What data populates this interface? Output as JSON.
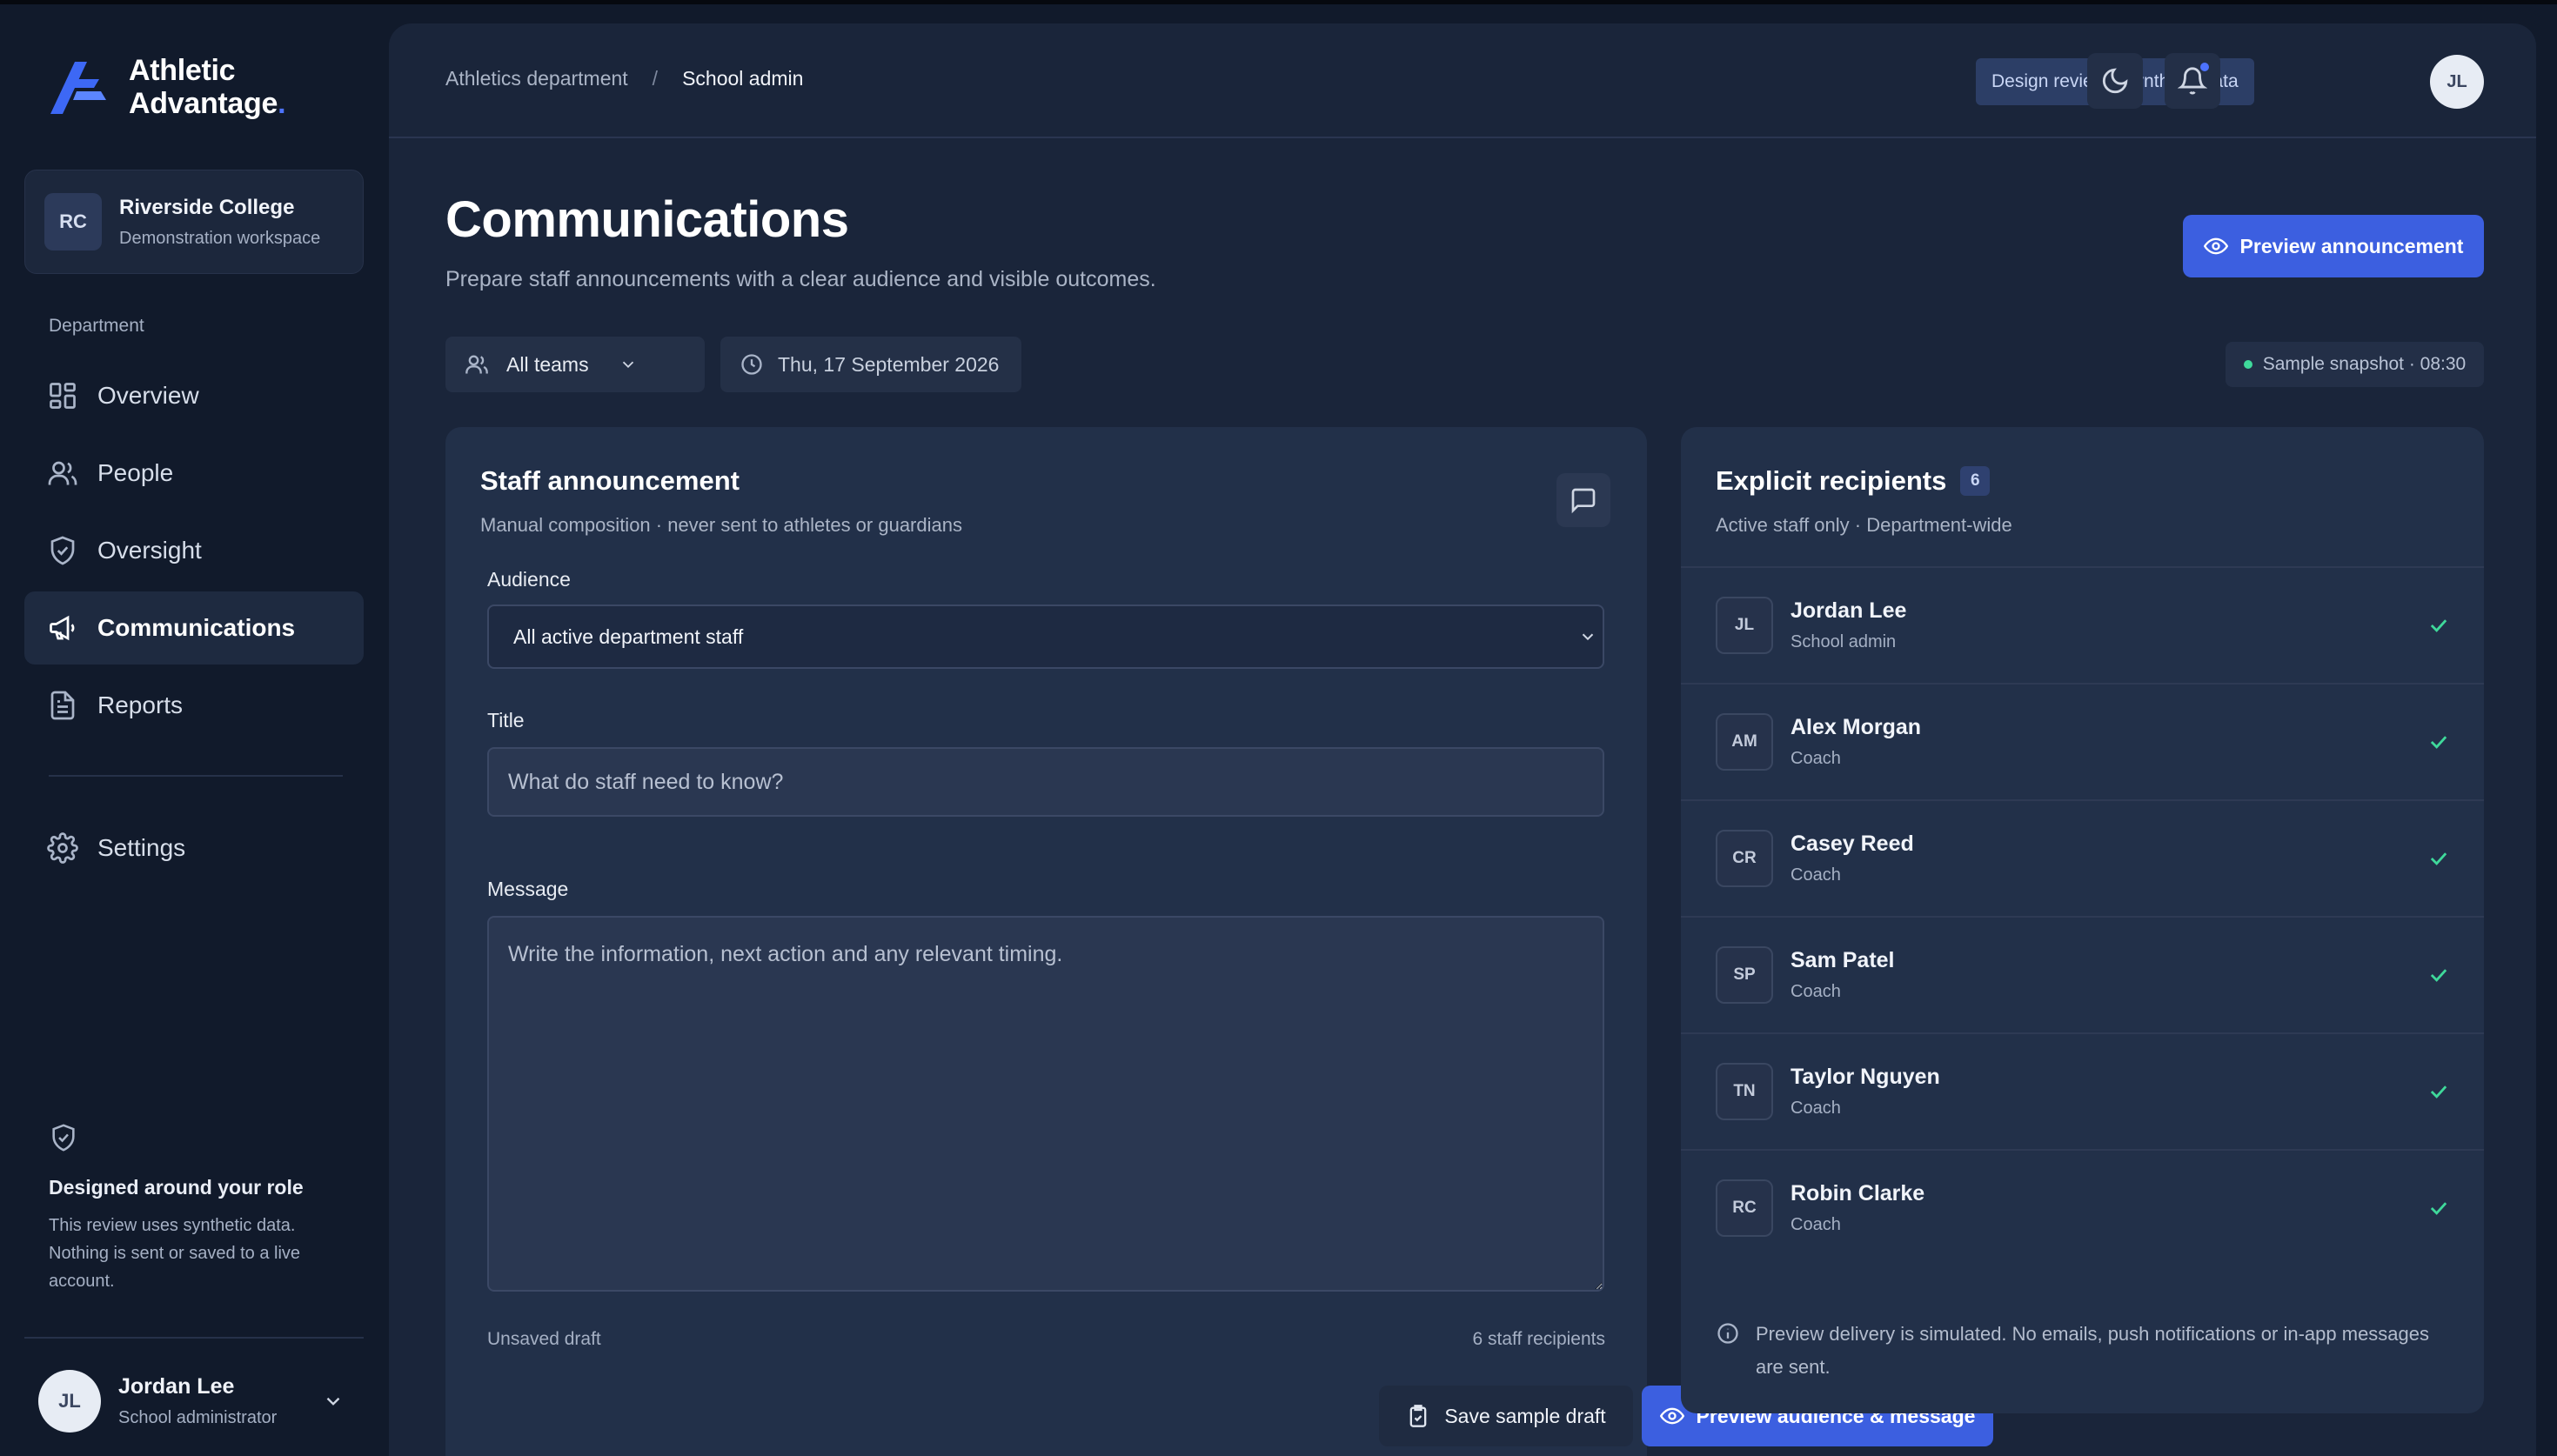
{
  "brand": {
    "line1": "Athletic",
    "line2": "Advantage",
    "dot": ".",
    "accent_color": "#4d73ff"
  },
  "organization": {
    "initials": "RC",
    "name": "Riverside College",
    "subtitle": "Demonstration workspace"
  },
  "sidebar": {
    "section_label": "Department",
    "items": [
      {
        "label": "Overview",
        "icon": "grid-icon"
      },
      {
        "label": "People",
        "icon": "people-icon"
      },
      {
        "label": "Oversight",
        "icon": "shield-check-icon"
      },
      {
        "label": "Communications",
        "icon": "megaphone-icon",
        "active": true
      },
      {
        "label": "Reports",
        "icon": "document-icon"
      }
    ],
    "settings": {
      "label": "Settings",
      "icon": "gear-icon"
    },
    "role_box": {
      "title": "Designed around your role",
      "text": "This review uses synthetic data. Nothing is sent or saved to a live account."
    },
    "user": {
      "initials": "JL",
      "name": "Jordan Lee",
      "role": "School administrator"
    }
  },
  "header": {
    "breadcrumb": [
      "Athletics department",
      "School admin"
    ],
    "breadcrumb_separator": "/",
    "badge": "Design review · Synthetic data",
    "avatar_initials": "JL"
  },
  "page": {
    "title": "Communications",
    "subtitle": "Prepare staff announcements with a clear audience and visible outcomes.",
    "primary_action": "Preview announcement"
  },
  "filters": {
    "team": "All teams",
    "date": "Thu, 17 September 2026",
    "snapshot": "Sample snapshot · 08:30"
  },
  "compose": {
    "title": "Staff announcement",
    "subtitle": "Manual composition · never sent to athletes or guardians",
    "audience_label": "Audience",
    "audience_value": "All active department staff",
    "title_label": "Title",
    "title_placeholder": "What do staff need to know?",
    "message_label": "Message",
    "message_placeholder": "Write the information, next action and any relevant timing.",
    "draft_status": "Unsaved draft",
    "recipient_count": "6 staff recipients",
    "save_label": "Save sample draft",
    "preview_label": "Preview audience & message"
  },
  "recipients": {
    "title": "Explicit recipients",
    "count": "6",
    "subtitle": "Active staff only · Department-wide",
    "list": [
      {
        "initials": "JL",
        "name": "Jordan Lee",
        "role": "School admin"
      },
      {
        "initials": "AM",
        "name": "Alex Morgan",
        "role": "Coach"
      },
      {
        "initials": "CR",
        "name": "Casey Reed",
        "role": "Coach"
      },
      {
        "initials": "SP",
        "name": "Sam Patel",
        "role": "Coach"
      },
      {
        "initials": "TN",
        "name": "Taylor Nguyen",
        "role": "Coach"
      },
      {
        "initials": "RC",
        "name": "Robin Clarke",
        "role": "Coach"
      }
    ],
    "note": "Preview delivery is simulated. No emails, push notifications or in-app messages are sent."
  },
  "colors": {
    "background": "#111a2b",
    "panel": "#1a253a",
    "card": "#223049",
    "primary": "#3c5fe0",
    "success": "#3fd99b"
  }
}
